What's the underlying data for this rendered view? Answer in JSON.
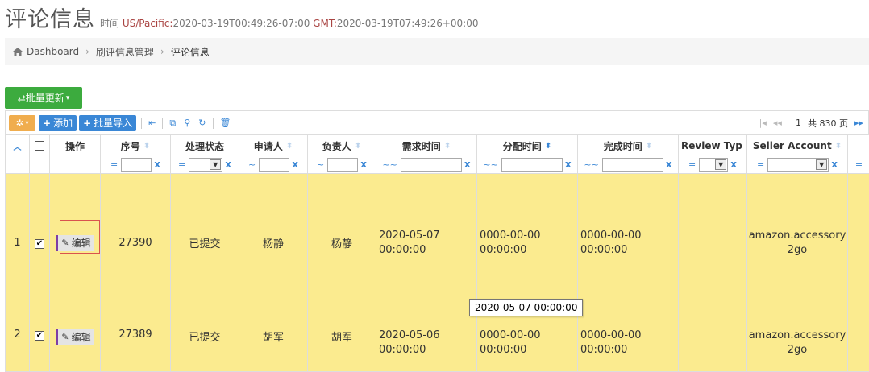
{
  "header": {
    "title": "评论信息",
    "time_label": "时间",
    "tz1": "US/Pacific:",
    "time1": "2020-03-19T00:49:26-07:00",
    "tz2": "GMT:",
    "time2": "2020-03-19T07:49:26+00:00"
  },
  "breadcrumb": {
    "home": "Dashboard",
    "level2": "刷评信息管理",
    "current": "评论信息"
  },
  "toolbar": {
    "bulk_update": "⇄批量更新",
    "add": "添加",
    "bulk_import": "批量导入"
  },
  "pager": {
    "page": "1",
    "total_label": "共 830 页"
  },
  "columns": {
    "ops": "操作",
    "seq": "序号",
    "status": "处理状态",
    "applicant": "申请人",
    "owner": "负责人",
    "req_time": "需求时间",
    "assign_time": "分配时间",
    "done_time": "完成时间",
    "review_type": "Review Typ",
    "seller_account": "Seller Account"
  },
  "filters": {
    "eq": "=",
    "like": "~",
    "range": "~~",
    "clear": "x"
  },
  "rows": [
    {
      "index": "1",
      "edit": "编辑",
      "seq": "27390",
      "status": "已提交",
      "applicant": "杨静",
      "owner": "杨静",
      "req_date": "2020-05-07",
      "req_clock": "00:00:00",
      "assign_date": "0000-00-00",
      "assign_clock": "00:00:00",
      "done_date": "0000-00-00",
      "done_clock": "00:00:00",
      "review_type": "",
      "seller_line1": "amazon.accessory",
      "seller_line2": "2go"
    },
    {
      "index": "2",
      "edit": "编辑",
      "seq": "27389",
      "status": "已提交",
      "applicant": "胡军",
      "owner": "胡军",
      "req_date": "2020-05-06",
      "req_clock": "00:00:00",
      "assign_date": "0000-00-00",
      "assign_clock": "00:00:00",
      "done_date": "0000-00-00",
      "done_clock": "00:00:00",
      "review_type": "",
      "seller_line1": "amazon.accessory",
      "seller_line2": "2go"
    }
  ],
  "tooltip": "2020-05-07 00:00:00",
  "colors": {
    "row_highlight": "#fbeb8f",
    "primary": "#3a87d6",
    "success": "#3cab3e",
    "warning": "#f0ad4e"
  }
}
